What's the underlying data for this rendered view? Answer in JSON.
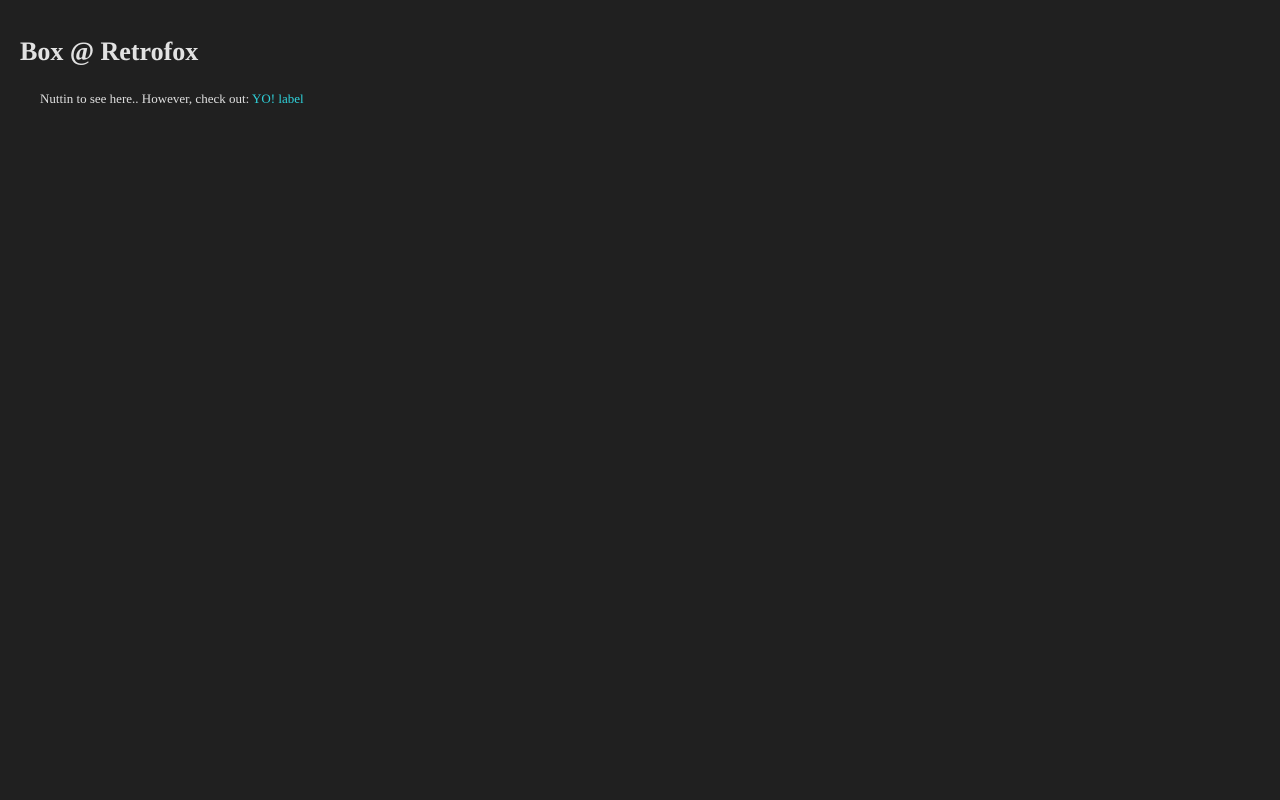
{
  "header": {
    "title": "Box @ Retrofox"
  },
  "main": {
    "message_text": "Nuttin to see here.. However, check out: ",
    "link_label": "YO! label"
  },
  "colors": {
    "background": "#202020",
    "text": "#e2e2e2",
    "link": "#2ecfd8"
  }
}
